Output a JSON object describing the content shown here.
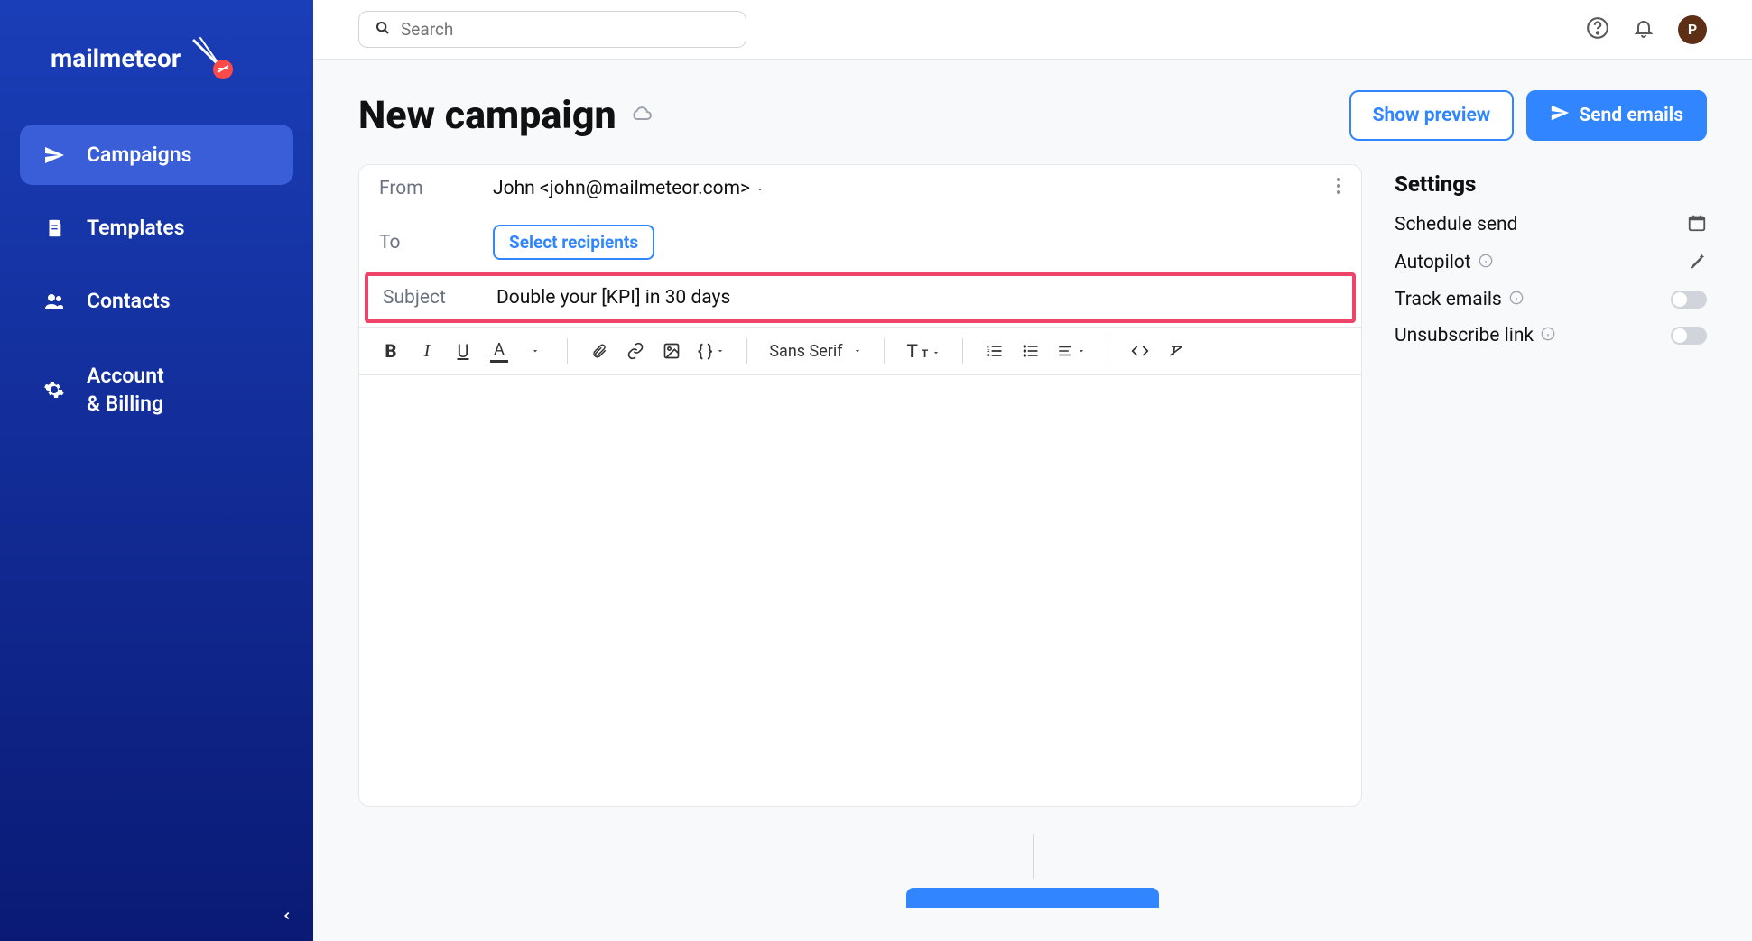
{
  "app": {
    "name": "mailmeteor"
  },
  "sidebar": {
    "items": [
      {
        "label": "Campaigns"
      },
      {
        "label": "Templates"
      },
      {
        "label": "Contacts"
      },
      {
        "label": "Account & Billing"
      }
    ]
  },
  "topbar": {
    "search_placeholder": "Search",
    "avatar_initial": "P"
  },
  "page": {
    "title": "New campaign",
    "show_preview_label": "Show preview",
    "send_label": "Send emails"
  },
  "composer": {
    "from_label": "From",
    "from_value": "John <john@mailmeteor.com>",
    "to_label": "To",
    "select_recipients_label": "Select recipients",
    "subject_label": "Subject",
    "subject_value": "Double your [KPI] in 30 days",
    "font": "Sans Serif"
  },
  "settings": {
    "title": "Settings",
    "items": [
      {
        "label": "Schedule send",
        "control": "calendar"
      },
      {
        "label": "Autopilot",
        "control": "wand",
        "info": true
      },
      {
        "label": "Track emails",
        "control": "toggle",
        "info": true
      },
      {
        "label": "Unsubscribe link",
        "control": "toggle",
        "info": true
      }
    ]
  }
}
